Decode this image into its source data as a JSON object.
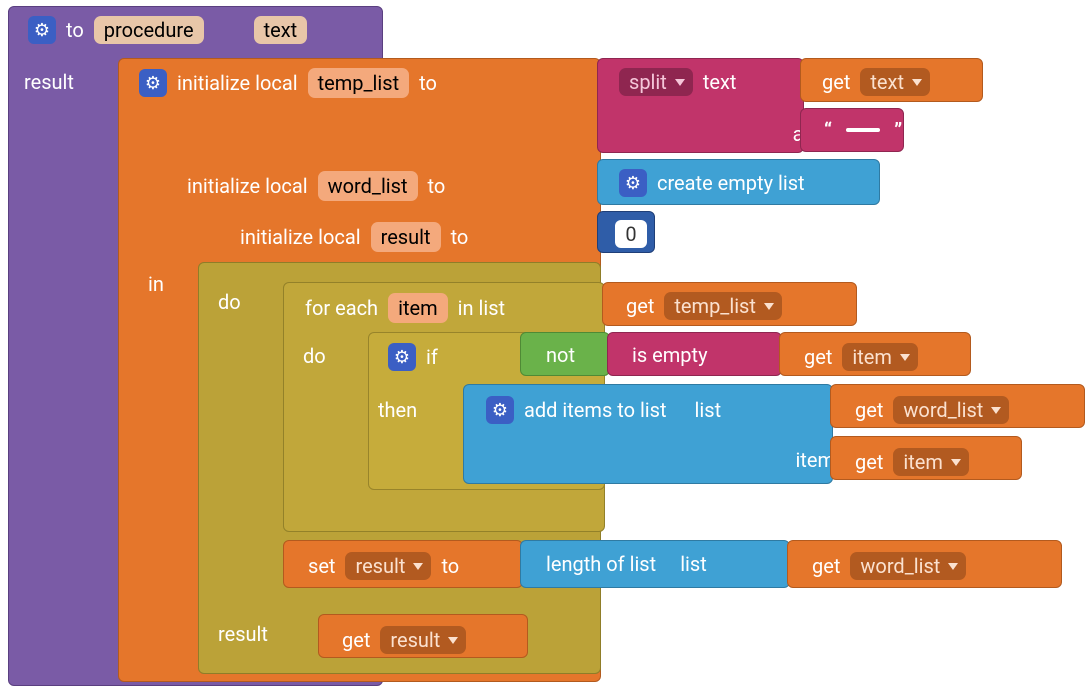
{
  "proc": {
    "to": "to",
    "name": "procedure",
    "param": "text",
    "result_label": "result"
  },
  "locals": {
    "init_label": "initialize local",
    "to_label": "to",
    "temp_list": "temp_list",
    "word_list": "word_list",
    "result": "result",
    "in_label": "in"
  },
  "split": {
    "label": "split",
    "text_label": "text",
    "at_label": "at",
    "get_label": "get",
    "get_text": "text",
    "space": " "
  },
  "create_empty": "create empty list",
  "zero": "0",
  "do_label": "do",
  "foreach": {
    "label1": "for each",
    "item": "item",
    "label2": "in list",
    "get": "get",
    "temp_list": "temp_list"
  },
  "inner_do": "do",
  "if_label": "if",
  "then_label": "then",
  "not_label": "not",
  "is_empty": "is empty",
  "get_item": {
    "get": "get",
    "item": "item"
  },
  "add_items": {
    "label": "add items to list",
    "list_label": "list",
    "item_label": "item",
    "get_wordlist": "word_list",
    "get_item": "item",
    "get": "get"
  },
  "set_result": {
    "set": "set",
    "result": "result",
    "to": "to"
  },
  "length_of_list": {
    "label": "length of list",
    "list_label": "list",
    "get": "get",
    "word_list": "word_list"
  },
  "final_result": {
    "label": "result",
    "get": "get",
    "result": "result"
  }
}
